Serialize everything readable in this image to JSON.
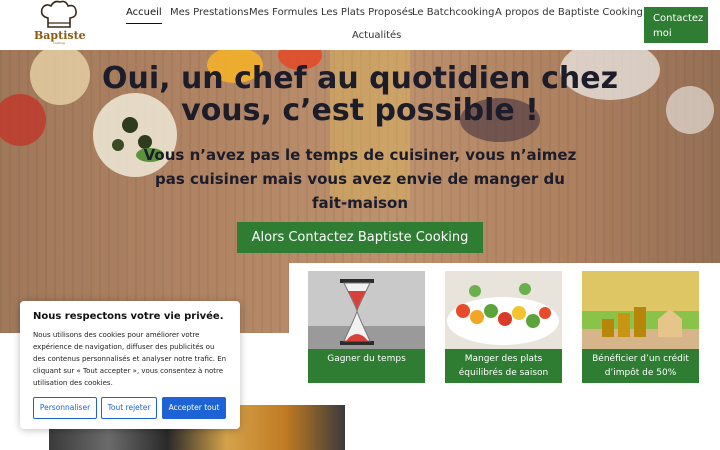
{
  "header": {
    "logo": {
      "name": "Baptiste",
      "tagline": "cooking"
    },
    "nav": [
      {
        "label": "Accueil",
        "active": true
      },
      {
        "label": "Mes Prestations"
      },
      {
        "label": "Mes Formules"
      },
      {
        "label": "Les Plats Proposés"
      },
      {
        "label": "Le Batchcooking"
      },
      {
        "label": "A propos de Baptiste Cooking"
      },
      {
        "label": "Actualités"
      }
    ],
    "contact_button": "Contactez moi"
  },
  "hero": {
    "title": "Oui, un chef au quotidien chez vous, c’est possible !",
    "subtitle": "Vous n’avez pas le temps de cuisiner, vous n’aimez pas cuisiner mais vous avez envie de manger du fait-maison",
    "cta": "Alors Contactez Baptiste Cooking"
  },
  "features": [
    {
      "caption": "Gagner du temps",
      "icon": "hourglass-image"
    },
    {
      "caption": "Manger des plats équilibrés de saison",
      "icon": "vegetable-skewers-image"
    },
    {
      "caption": "Bénéficier d’un crédit d’impôt de 50%",
      "icon": "coins-house-image"
    }
  ],
  "cookie_banner": {
    "title": "Nous respectons votre vie privée.",
    "text": "Nous utilisons des cookies pour améliorer votre expérience de navigation, diffuser des publicités ou des contenus personnalisés et analyser notre trafic. En cliquant sur « Tout accepter », vous consentez à notre utilisation des cookies.",
    "buttons": {
      "customize": "Personnaliser",
      "reject": "Tout rejeter",
      "accept": "Accepter tout"
    }
  },
  "colors": {
    "accent_green": "#2e7d32",
    "cookie_blue": "#1d63d6",
    "title_dark": "#1c1c2a"
  }
}
